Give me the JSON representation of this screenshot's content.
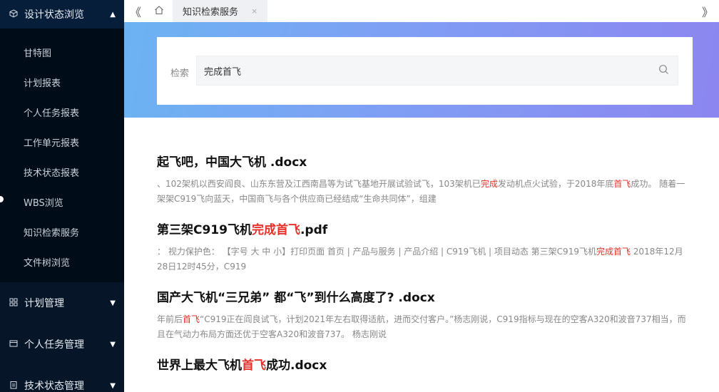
{
  "sidebar": {
    "expanded_group": {
      "label": "设计状态浏览",
      "icon": "cube-icon",
      "arrow": "▲"
    },
    "sub_items": [
      "甘特图",
      "计划报表",
      "个人任务报表",
      "工作单元报表",
      "技术状态报表",
      "WBS浏览",
      "知识检索服务",
      "文件树浏览"
    ],
    "collapsed_groups": [
      {
        "label": "计划管理",
        "icon": "grid-icon",
        "arrow": "▼"
      },
      {
        "label": "个人任务管理",
        "icon": "window-icon",
        "arrow": "▼"
      },
      {
        "label": "技术状态管理",
        "icon": "clipboard-icon",
        "arrow": "▼"
      }
    ]
  },
  "tabbar": {
    "prev": "《",
    "next": "》",
    "active_tab": "知识检索服务",
    "close": "×"
  },
  "search": {
    "label": "检索",
    "value": "完成首飞"
  },
  "results": [
    {
      "title_parts": [
        "起飞吧，中国大飞机 .docx"
      ],
      "title_hl": [
        false
      ],
      "desc_parts": [
        "、102架机以西安阎良、山东东营及江西南昌等为试飞基地开展试验试飞，103架机已",
        "完成",
        "发动机点火试验，于2018年底",
        "首飞",
        "成功。 随着一架架C919飞向蓝天，中国商飞与各个供应商已经结成“生命共同体”，组建"
      ],
      "desc_hl": [
        false,
        true,
        false,
        true,
        false
      ]
    },
    {
      "title_parts": [
        "第三架C919飞机",
        "完成首飞",
        ".pdf"
      ],
      "title_hl": [
        false,
        true,
        false
      ],
      "desc_parts": [
        "： 视力保护色： 【字号 大 中 小】打印页面 首页 | 产品与服务 | 产品介绍 | C919飞机 | 项目动态 第三架C919飞机",
        "完成首飞",
        "   2018年12月28日12时45分，C919"
      ],
      "desc_hl": [
        false,
        true,
        false
      ]
    },
    {
      "title_parts": [
        "国产大飞机“三兄弟” 都“飞”到什么高度了? .docx"
      ],
      "title_hl": [
        false
      ],
      "desc_parts": [
        "年前后",
        "首飞",
        "“C919正在阎良试飞，计划2021年左右取得适航，进而交付客户。”杨志刚说，C919指标与现在的空客A320和波音737相当，而且在气动力布局方面还优于空客A320和波音737。 杨志刚说"
      ],
      "desc_hl": [
        false,
        true,
        false
      ]
    },
    {
      "title_parts": [
        "世界上最大飞机",
        "首飞",
        "成功.docx"
      ],
      "title_hl": [
        false,
        true,
        false
      ],
      "desc_parts": [],
      "desc_hl": []
    }
  ]
}
